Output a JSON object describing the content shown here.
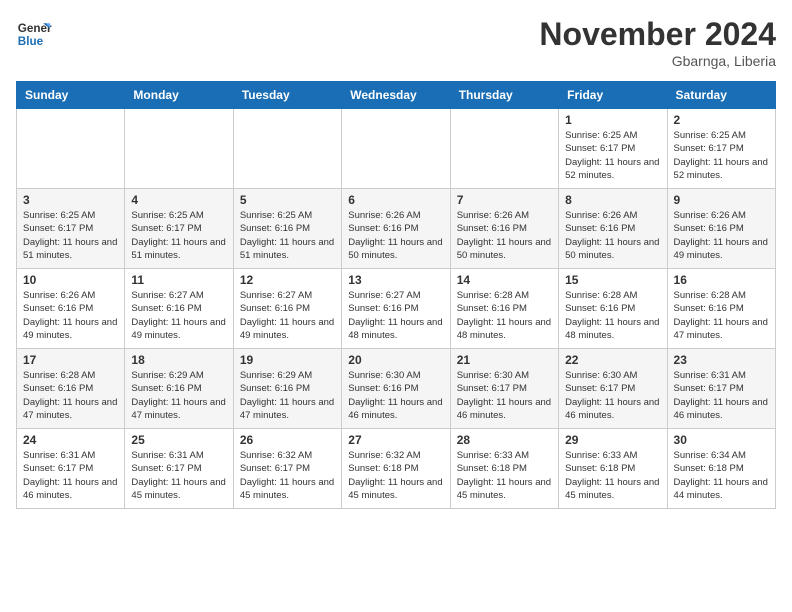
{
  "header": {
    "logo_line1": "General",
    "logo_line2": "Blue",
    "month": "November 2024",
    "location": "Gbarnga, Liberia"
  },
  "days_of_week": [
    "Sunday",
    "Monday",
    "Tuesday",
    "Wednesday",
    "Thursday",
    "Friday",
    "Saturday"
  ],
  "weeks": [
    [
      {
        "day": "",
        "info": ""
      },
      {
        "day": "",
        "info": ""
      },
      {
        "day": "",
        "info": ""
      },
      {
        "day": "",
        "info": ""
      },
      {
        "day": "",
        "info": ""
      },
      {
        "day": "1",
        "info": "Sunrise: 6:25 AM\nSunset: 6:17 PM\nDaylight: 11 hours and 52 minutes."
      },
      {
        "day": "2",
        "info": "Sunrise: 6:25 AM\nSunset: 6:17 PM\nDaylight: 11 hours and 52 minutes."
      }
    ],
    [
      {
        "day": "3",
        "info": "Sunrise: 6:25 AM\nSunset: 6:17 PM\nDaylight: 11 hours and 51 minutes."
      },
      {
        "day": "4",
        "info": "Sunrise: 6:25 AM\nSunset: 6:17 PM\nDaylight: 11 hours and 51 minutes."
      },
      {
        "day": "5",
        "info": "Sunrise: 6:25 AM\nSunset: 6:16 PM\nDaylight: 11 hours and 51 minutes."
      },
      {
        "day": "6",
        "info": "Sunrise: 6:26 AM\nSunset: 6:16 PM\nDaylight: 11 hours and 50 minutes."
      },
      {
        "day": "7",
        "info": "Sunrise: 6:26 AM\nSunset: 6:16 PM\nDaylight: 11 hours and 50 minutes."
      },
      {
        "day": "8",
        "info": "Sunrise: 6:26 AM\nSunset: 6:16 PM\nDaylight: 11 hours and 50 minutes."
      },
      {
        "day": "9",
        "info": "Sunrise: 6:26 AM\nSunset: 6:16 PM\nDaylight: 11 hours and 49 minutes."
      }
    ],
    [
      {
        "day": "10",
        "info": "Sunrise: 6:26 AM\nSunset: 6:16 PM\nDaylight: 11 hours and 49 minutes."
      },
      {
        "day": "11",
        "info": "Sunrise: 6:27 AM\nSunset: 6:16 PM\nDaylight: 11 hours and 49 minutes."
      },
      {
        "day": "12",
        "info": "Sunrise: 6:27 AM\nSunset: 6:16 PM\nDaylight: 11 hours and 49 minutes."
      },
      {
        "day": "13",
        "info": "Sunrise: 6:27 AM\nSunset: 6:16 PM\nDaylight: 11 hours and 48 minutes."
      },
      {
        "day": "14",
        "info": "Sunrise: 6:28 AM\nSunset: 6:16 PM\nDaylight: 11 hours and 48 minutes."
      },
      {
        "day": "15",
        "info": "Sunrise: 6:28 AM\nSunset: 6:16 PM\nDaylight: 11 hours and 48 minutes."
      },
      {
        "day": "16",
        "info": "Sunrise: 6:28 AM\nSunset: 6:16 PM\nDaylight: 11 hours and 47 minutes."
      }
    ],
    [
      {
        "day": "17",
        "info": "Sunrise: 6:28 AM\nSunset: 6:16 PM\nDaylight: 11 hours and 47 minutes."
      },
      {
        "day": "18",
        "info": "Sunrise: 6:29 AM\nSunset: 6:16 PM\nDaylight: 11 hours and 47 minutes."
      },
      {
        "day": "19",
        "info": "Sunrise: 6:29 AM\nSunset: 6:16 PM\nDaylight: 11 hours and 47 minutes."
      },
      {
        "day": "20",
        "info": "Sunrise: 6:30 AM\nSunset: 6:16 PM\nDaylight: 11 hours and 46 minutes."
      },
      {
        "day": "21",
        "info": "Sunrise: 6:30 AM\nSunset: 6:17 PM\nDaylight: 11 hours and 46 minutes."
      },
      {
        "day": "22",
        "info": "Sunrise: 6:30 AM\nSunset: 6:17 PM\nDaylight: 11 hours and 46 minutes."
      },
      {
        "day": "23",
        "info": "Sunrise: 6:31 AM\nSunset: 6:17 PM\nDaylight: 11 hours and 46 minutes."
      }
    ],
    [
      {
        "day": "24",
        "info": "Sunrise: 6:31 AM\nSunset: 6:17 PM\nDaylight: 11 hours and 46 minutes."
      },
      {
        "day": "25",
        "info": "Sunrise: 6:31 AM\nSunset: 6:17 PM\nDaylight: 11 hours and 45 minutes."
      },
      {
        "day": "26",
        "info": "Sunrise: 6:32 AM\nSunset: 6:17 PM\nDaylight: 11 hours and 45 minutes."
      },
      {
        "day": "27",
        "info": "Sunrise: 6:32 AM\nSunset: 6:18 PM\nDaylight: 11 hours and 45 minutes."
      },
      {
        "day": "28",
        "info": "Sunrise: 6:33 AM\nSunset: 6:18 PM\nDaylight: 11 hours and 45 minutes."
      },
      {
        "day": "29",
        "info": "Sunrise: 6:33 AM\nSunset: 6:18 PM\nDaylight: 11 hours and 45 minutes."
      },
      {
        "day": "30",
        "info": "Sunrise: 6:34 AM\nSunset: 6:18 PM\nDaylight: 11 hours and 44 minutes."
      }
    ]
  ]
}
